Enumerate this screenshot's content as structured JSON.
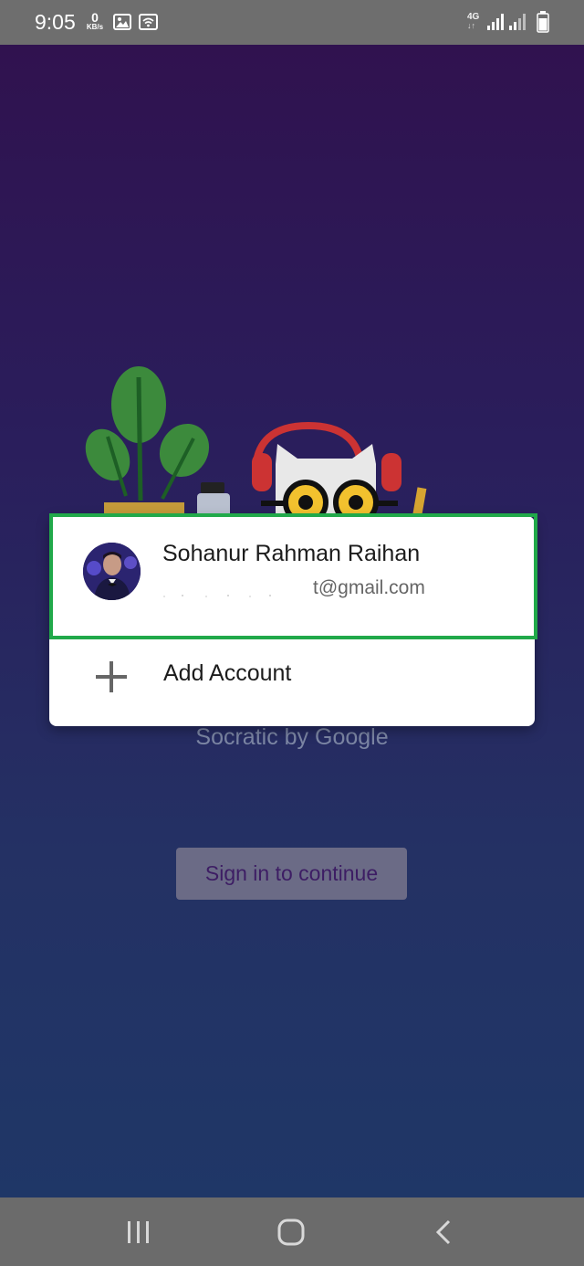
{
  "status_bar": {
    "time": "9:05",
    "net_speed_value": "0",
    "net_speed_unit": "KB/s",
    "network_type": "4G",
    "network_arrows": "↓↑"
  },
  "app": {
    "brand_text": "Socratic by Google",
    "signin_label": "Sign in to continue"
  },
  "account_dialog": {
    "account": {
      "name": "Sohanur Rahman Raihan",
      "email_visible": "t@gmail.com"
    },
    "add_account_label": "Add Account",
    "highlight_color": "#21a94a"
  },
  "icons": {
    "status": [
      "gallery-icon",
      "wifi-status-icon",
      "signal-icon",
      "battery-icon"
    ],
    "nav": [
      "recents-icon",
      "home-icon",
      "back-icon"
    ],
    "dialog": [
      "avatar",
      "plus-icon"
    ]
  }
}
